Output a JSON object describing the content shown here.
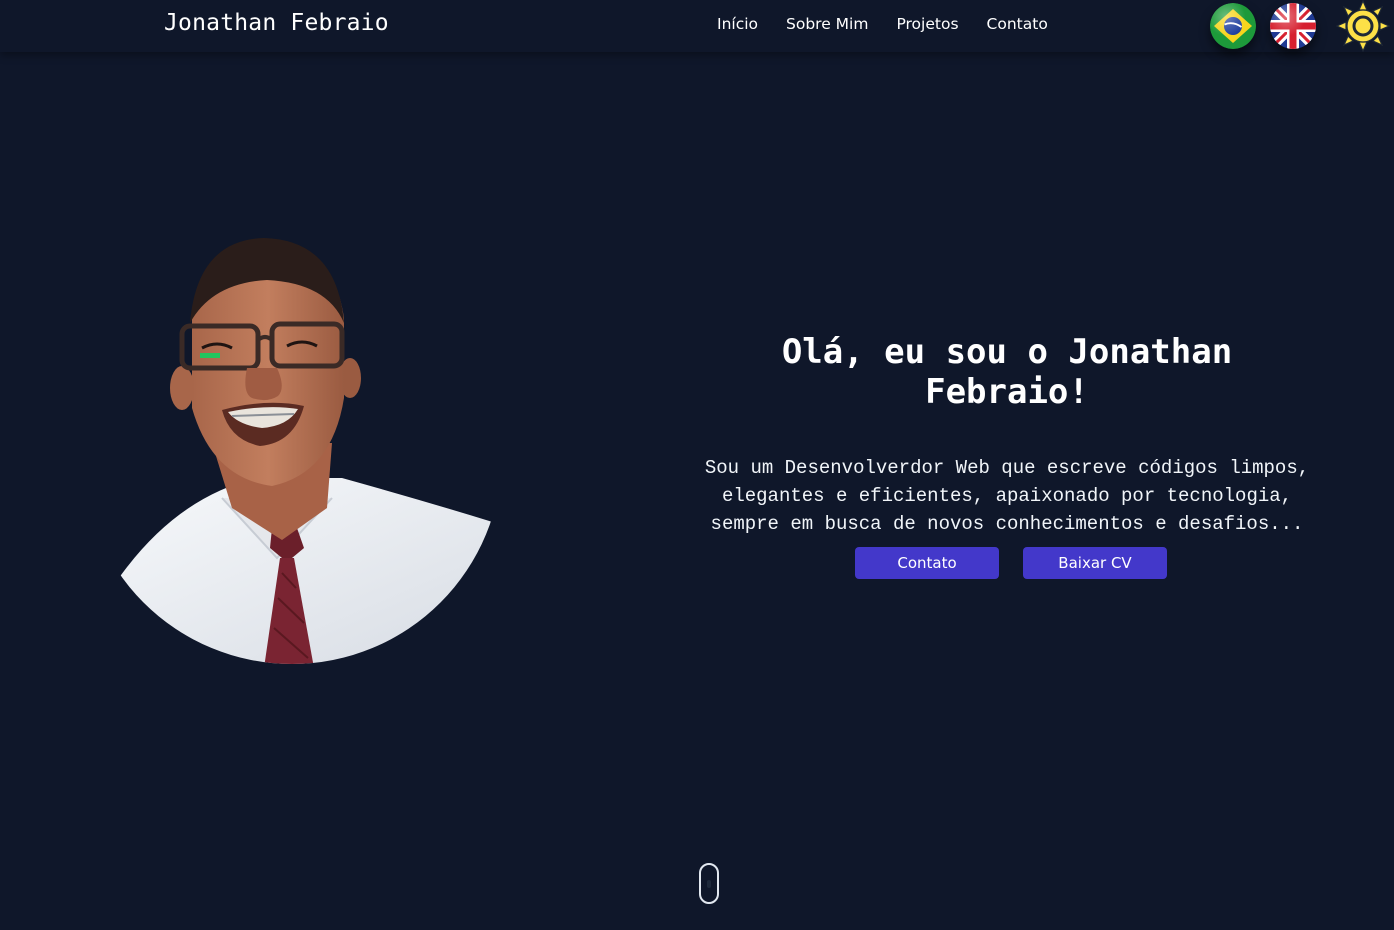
{
  "header": {
    "brand": "Jonathan Febraio",
    "nav": [
      {
        "label": "Início"
      },
      {
        "label": "Sobre Mim"
      },
      {
        "label": "Projetos"
      },
      {
        "label": "Contato"
      }
    ],
    "languages": [
      {
        "icon": "brazil-flag-icon"
      },
      {
        "icon": "uk-flag-icon"
      }
    ],
    "theme_toggle_icon": "sun-icon"
  },
  "hero": {
    "title_line1": "Olá, eu sou o Jonathan",
    "title_line2": "Febraio!",
    "description_lines": [
      "Sou um Desenvolverdor Web que escreve códigos limpos,",
      "elegantes e eficientes, apaixonado por tecnologia,",
      "sempre em busca de novos conhecimentos e desafios..."
    ],
    "contact_button": "Contato",
    "cv_button": "Baixar CV"
  },
  "colors": {
    "background": "#0f172a",
    "button": "#4338ca",
    "sun": "#fde047"
  }
}
